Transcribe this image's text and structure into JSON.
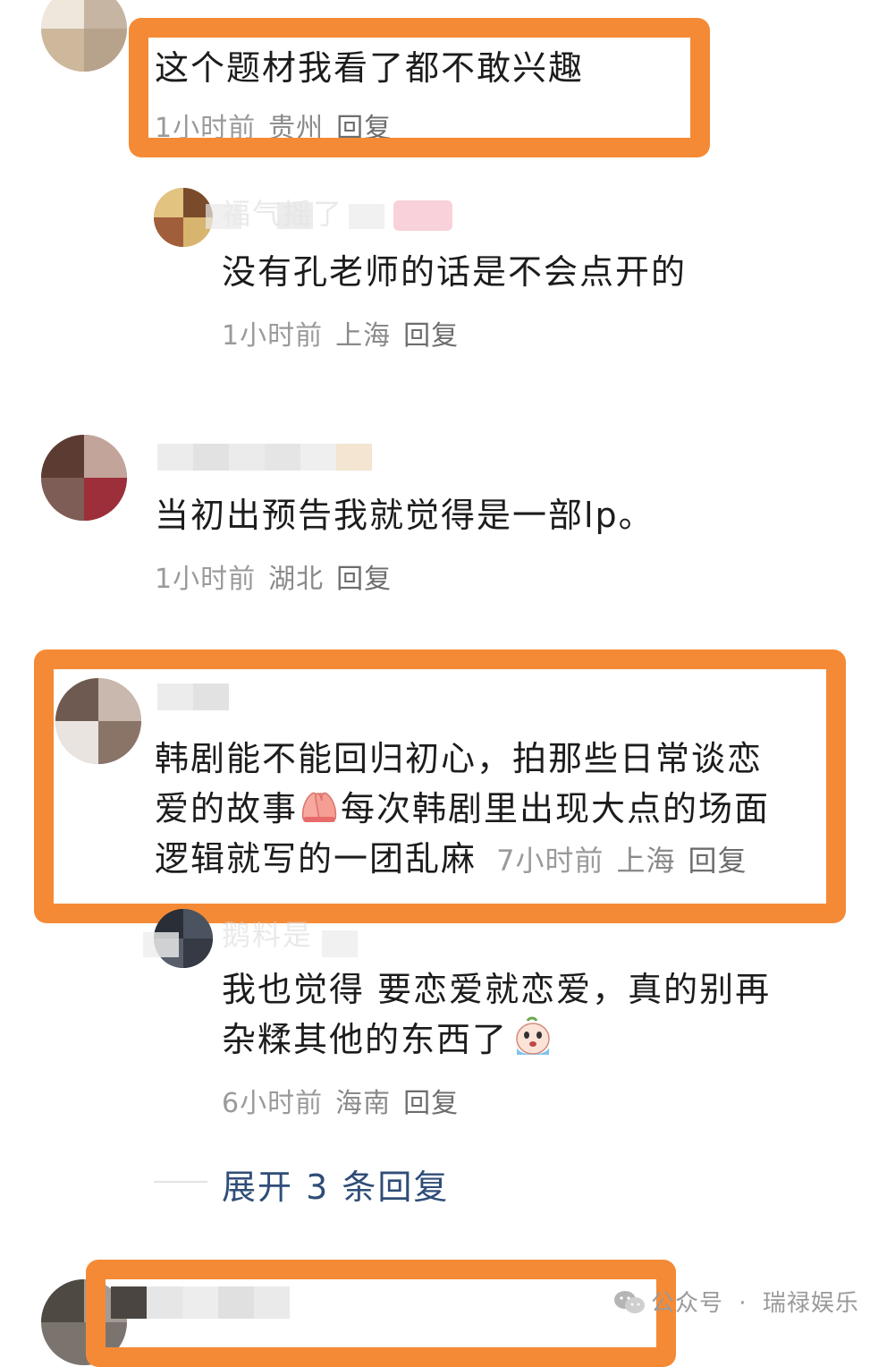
{
  "comments": [
    {
      "text": "这个题材我看了都不敢兴趣",
      "time": "1小时前",
      "location": "贵州",
      "reply": "回复"
    },
    {
      "username_partial": "福气摇了",
      "text": "没有孔老师的话是不会点开的",
      "time": "1小时前",
      "location": "上海",
      "reply": "回复"
    },
    {
      "text": "当初出预告我就觉得是一部lp。",
      "time": "1小时前",
      "location": "湖北",
      "reply": "回复"
    },
    {
      "text_line1": "韩剧能不能回归初心，拍那些日常谈恋",
      "text_line2a": "爱的故事",
      "text_line2b": "每次韩剧里出现大点的场面",
      "text_line3": "逻辑就写的一团乱麻",
      "time": "7小时前",
      "location": "上海",
      "reply": "回复"
    },
    {
      "username_partial": "鹅料是",
      "text_line1": "我也觉得 要恋爱就恋爱，真的别再",
      "text_line2": "杂糅其他的东西了",
      "time": "6小时前",
      "location": "海南",
      "reply": "回复"
    }
  ],
  "expand_replies": "展开 3 条回复",
  "watermark": {
    "account_type": "公众号",
    "separator": "·",
    "account_name": "瑞禄娱乐"
  },
  "colors": {
    "highlight": "#f58a36",
    "link": "#2f4d78",
    "meta_text": "#8a8a8a"
  },
  "icons": [
    "hands-emoji-icon",
    "crying-face-emoji-icon",
    "wechat-icon"
  ]
}
